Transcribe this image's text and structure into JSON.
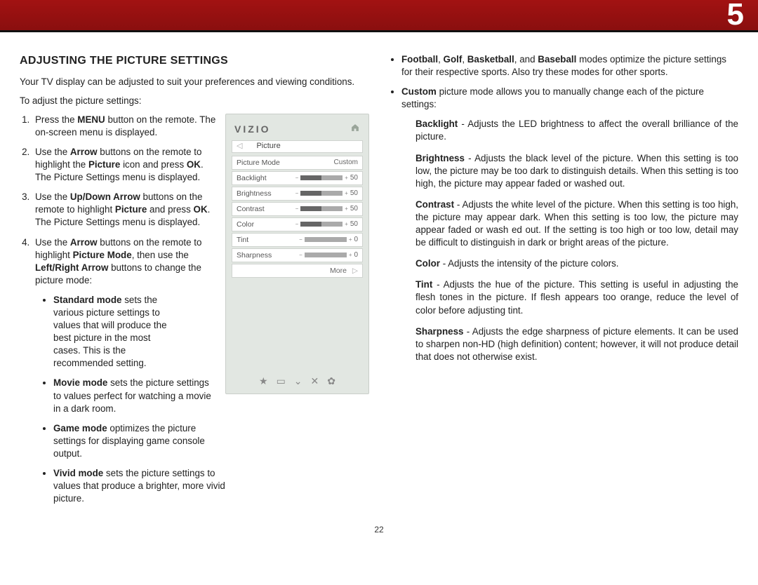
{
  "chapter_number": "5",
  "page_number": "22",
  "heading": "ADJUSTING THE PICTURE SETTINGS",
  "intro": "Your TV display can be adjusted to suit your preferences and viewing conditions.",
  "lead": "To adjust the picture settings:",
  "steps": {
    "s1a": "Press the ",
    "s1b": "MENU",
    "s1c": " button on the remote. The on-screen menu is displayed.",
    "s2a": "Use the ",
    "s2b": "Arrow",
    "s2c": " buttons on the remote to highlight the ",
    "s2d": "Picture",
    "s2e": " icon and press ",
    "s2f": "OK",
    "s2g": ". The Picture Settings menu is displayed.",
    "s3a": "Use the ",
    "s3b": "Up/Down Arrow",
    "s3c": " buttons on the remote to highlight ",
    "s3d": "Picture",
    "s3e": " and press ",
    "s3f": "OK",
    "s3g": ". The Picture Settings menu is displayed.",
    "s4a": "Use the ",
    "s4b": "Arrow",
    "s4c": " buttons on the remote to highlight ",
    "s4d": "Picture Mode",
    "s4e": ", then use the ",
    "s4f": "Left/Right Arrow",
    "s4g": " buttons to change the picture mode:"
  },
  "modes": {
    "standard_b": "Standard mode",
    "standard_t": " sets the various picture settings to values that will produce the best picture in the most cases. This is the recommended setting.",
    "movie_b": "Movie mode",
    "movie_t": " sets the picture settings to values perfect for watching a movie in a dark room.",
    "game_b": "Game mode",
    "game_t": " optimizes the picture settings for displaying game console output.",
    "vivid_b": "Vivid mode",
    "vivid_t": " sets the picture settings to values that produce a brighter, more vivid picture."
  },
  "col2_top": {
    "sports_b1": "Football",
    "sports_b2": "Golf",
    "sports_b3": "Basketball",
    "sports_b4": "Baseball",
    "sports_t": " modes optimize the picture settings for their respective sports. Also try these modes for other sports.",
    "custom_b": "Custom",
    "custom_t": " picture mode allows you to manually change each of the picture settings:"
  },
  "defs": {
    "backlight_b": "Backlight",
    "backlight_t": " - Adjusts the LED brightness to affect the overall brilliance of the picture.",
    "brightness_b": "Brightness",
    "brightness_t": " - Adjusts the black level of the picture. When this setting is too low, the picture may be too dark to distinguish details. When this setting is too high, the picture may appear faded or washed out.",
    "contrast_b": "Contrast",
    "contrast_t": " - Adjusts the white level of the picture. When this setting is too high, the picture may appear dark. When this setting is too low, the picture may appear faded or wash ed out. If the setting is too high or too low, detail may be difficult to distinguish in dark or bright areas of the picture.",
    "color_b": "Color",
    "color_t": " - Adjusts the intensity of the picture colors.",
    "tint_b": "Tint",
    "tint_t": " - Adjusts the hue of the picture. This setting is useful in adjusting the flesh tones in the picture. If flesh appears too orange, reduce the level of color before adjusting tint.",
    "sharp_b": "Sharpness",
    "sharp_t": " - Adjusts the edge sharpness of picture elements. It can be used to sharpen non-HD (high definition) content; however, it will not produce detail that does not otherwise exist."
  },
  "menu": {
    "logo": "VIZIO",
    "crumb": "Picture",
    "mode_label": "Picture Mode",
    "mode_value": "Custom",
    "backlight": "Backlight",
    "backlight_v": "50",
    "brightness": "Brightness",
    "brightness_v": "50",
    "contrast": "Contrast",
    "contrast_v": "50",
    "color": "Color",
    "color_v": "50",
    "tint": "Tint",
    "tint_v": "0",
    "sharpness": "Sharpness",
    "sharpness_v": "0",
    "more": "More"
  },
  "chart_data": {
    "type": "table",
    "title": "Picture Settings Menu",
    "rows": [
      {
        "name": "Picture Mode",
        "value": "Custom"
      },
      {
        "name": "Backlight",
        "value": 50,
        "range": [
          0,
          100
        ]
      },
      {
        "name": "Brightness",
        "value": 50,
        "range": [
          0,
          100
        ]
      },
      {
        "name": "Contrast",
        "value": 50,
        "range": [
          0,
          100
        ]
      },
      {
        "name": "Color",
        "value": 50,
        "range": [
          0,
          100
        ]
      },
      {
        "name": "Tint",
        "value": 0,
        "range": [
          0,
          100
        ]
      },
      {
        "name": "Sharpness",
        "value": 0,
        "range": [
          0,
          100
        ]
      }
    ]
  }
}
